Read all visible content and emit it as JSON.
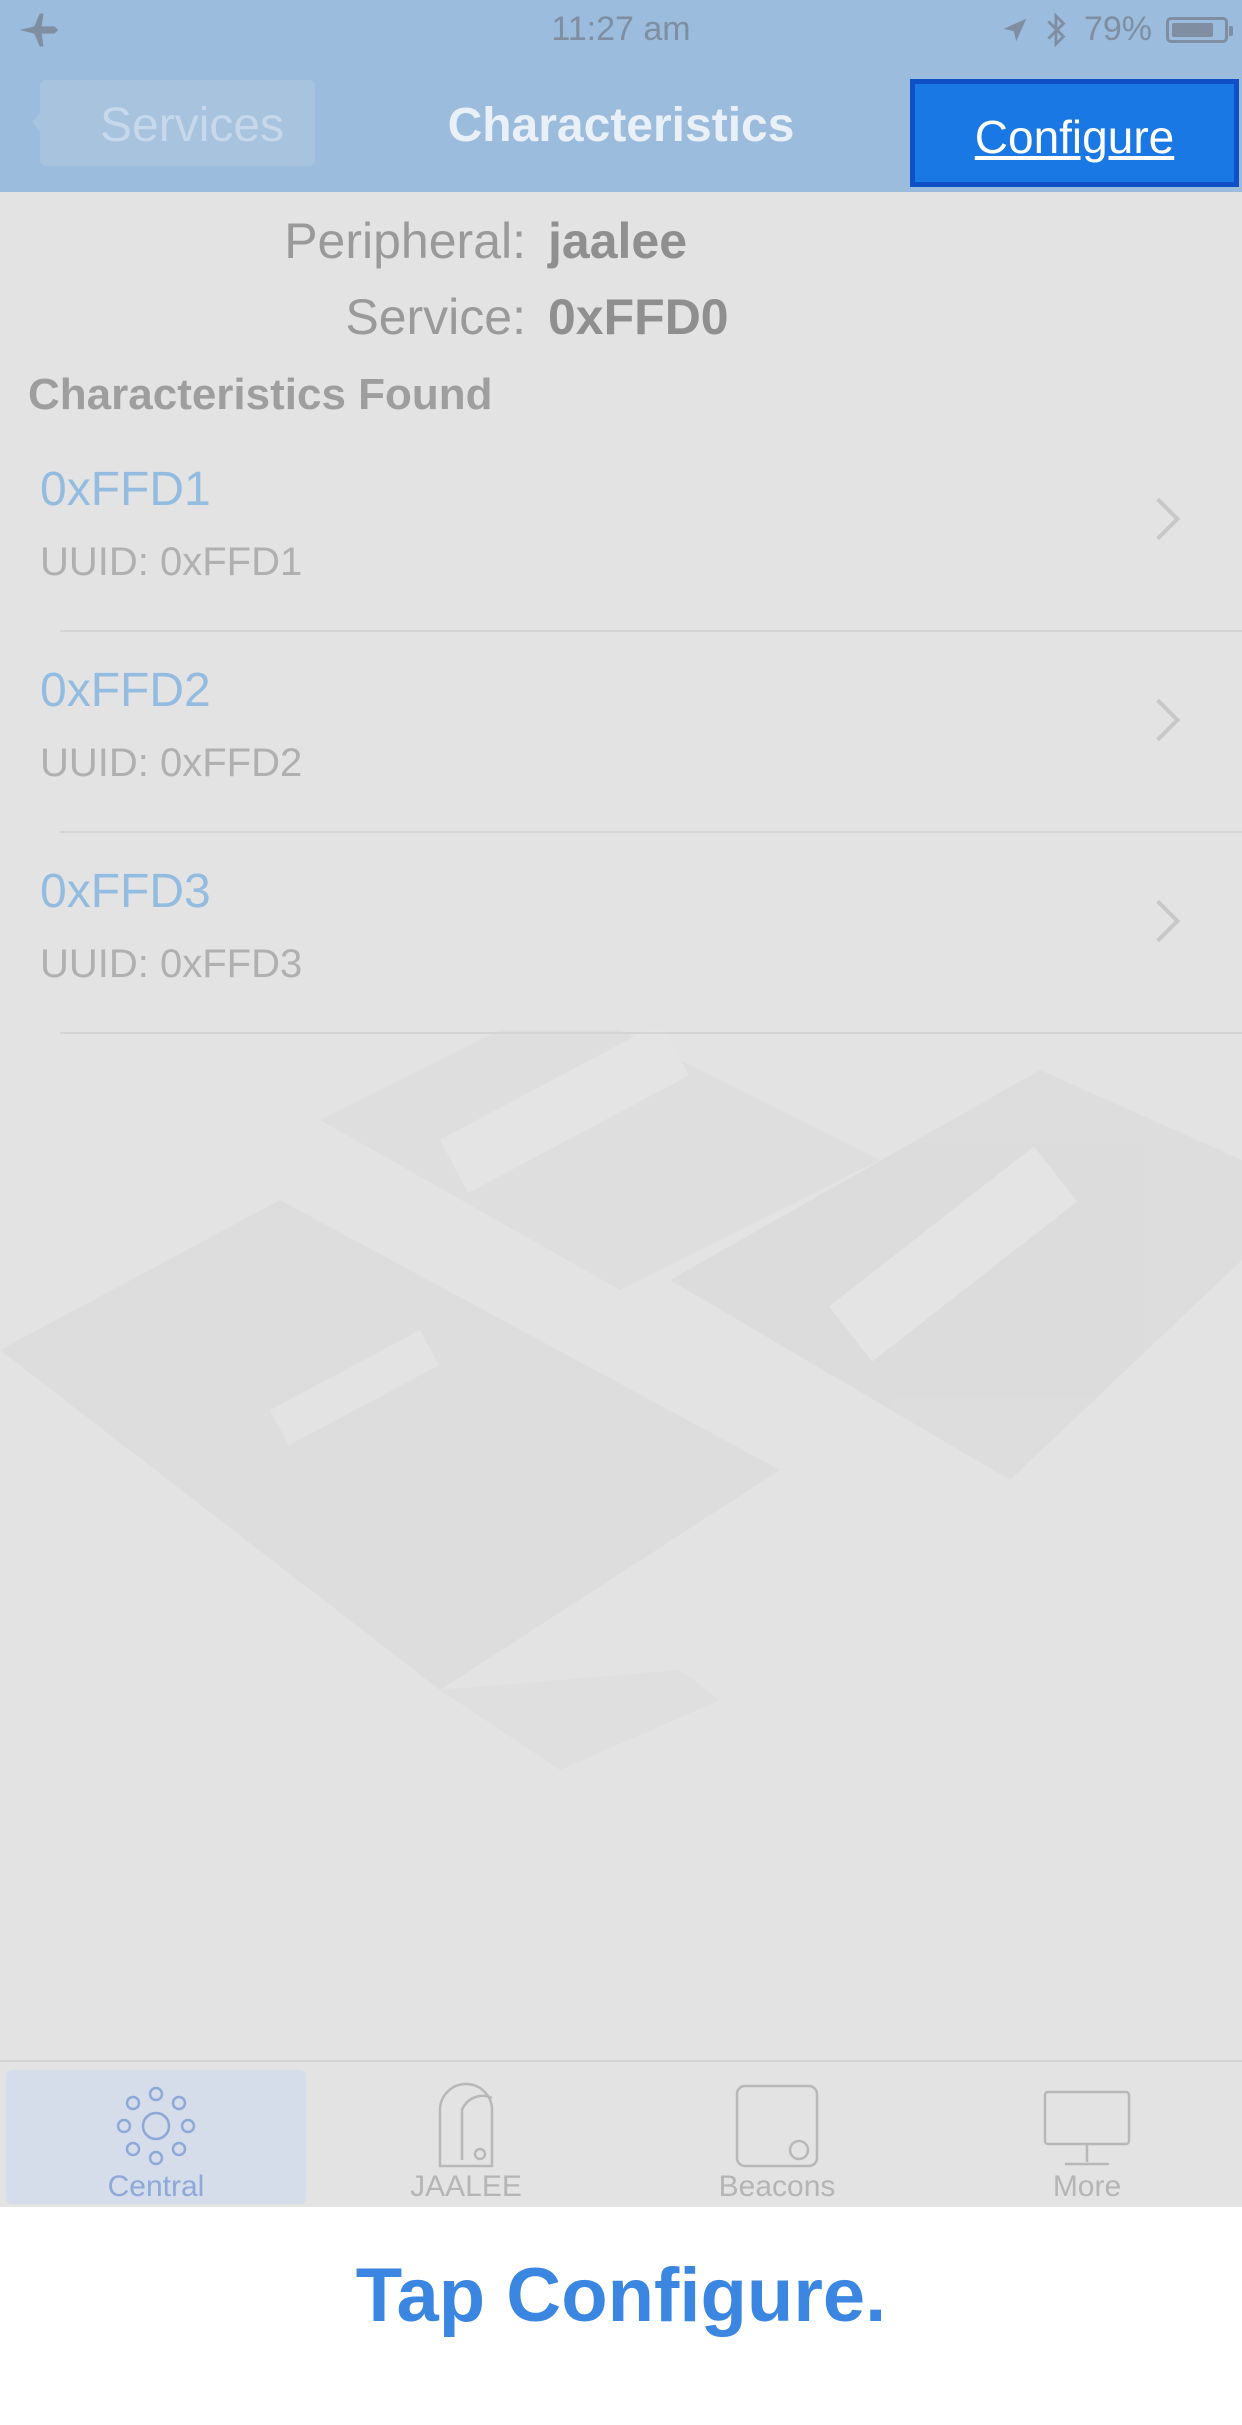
{
  "status_bar": {
    "time": "11:27 am",
    "battery": "79%",
    "battery_level": 0.79
  },
  "nav": {
    "back_label": "Services",
    "title": "Characteristics",
    "configure_label": "Configure"
  },
  "info": {
    "peripheral_label": "Peripheral:",
    "peripheral_value": "jaalee",
    "service_label": "Service:",
    "service_value": "0xFFD0"
  },
  "section_title": "Characteristics Found",
  "characteristics": [
    {
      "name": "0xFFD1",
      "uuid": "UUID: 0xFFD1"
    },
    {
      "name": "0xFFD2",
      "uuid": "UUID: 0xFFD2"
    },
    {
      "name": "0xFFD3",
      "uuid": "UUID: 0xFFD3"
    }
  ],
  "tabs": [
    {
      "label": "Central",
      "icon": "central-icon",
      "active": true
    },
    {
      "label": "JAALEE",
      "icon": "jaalee-tag-icon",
      "active": false
    },
    {
      "label": "Beacons",
      "icon": "beacon-icon",
      "active": false
    },
    {
      "label": "More",
      "icon": "monitor-icon",
      "active": false
    }
  ],
  "caption": "Tap Configure.",
  "colors": {
    "nav_bg": "#9bbcdc",
    "highlight": "#1a78e4",
    "caption": "#3a86e0"
  }
}
